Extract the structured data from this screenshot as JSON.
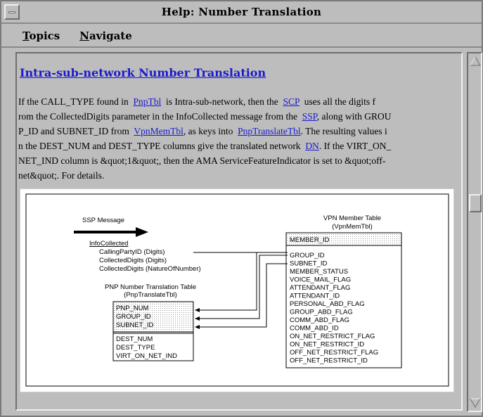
{
  "window": {
    "title": "Help: Number Translation"
  },
  "menubar": {
    "topics_mnemonic": "T",
    "topics_rest": "opics",
    "navigate_mnemonic": "N",
    "navigate_rest": "avigate"
  },
  "content": {
    "heading": "Intra-sub-network Number Translation",
    "para": {
      "t1": "If the CALL_TYPE found in  ",
      "l1": "PnpTbl",
      "t2": "  is Intra-sub-network, then the  ",
      "l2": "SCP",
      "t3": "  uses all the digits f\nrom the CollectedDigits parameter in the InfoCollected message from the  ",
      "l3": "SSP",
      "t4": ", along with GROU\nP_ID and SUBNET_ID from  ",
      "l4": "VpnMemTbl",
      "t5": ", as keys into  ",
      "l5": "PnpTranslateTbl",
      "t6": ". The resulting values i\nn the DEST_NUM and DEST_TYPE columns give the translated network  ",
      "l6": "DN",
      "t7": ". If the VIRT_ON_\nNET_IND column is &quot;1&quot;, then the AMA ServiceFeatureIndicator is set to &quot;off-\nnet&quot;. For details."
    }
  },
  "figure": {
    "ssp_label": "SSP Message",
    "info_collected": "InfoCollected",
    "params": [
      "CallingPartyID (Digits)",
      "CollectedDigits (Digits)",
      "CollectedDigits (NatureOfNumber)"
    ],
    "pnp_title_1": "PNP Number Translation Table",
    "pnp_title_2": "(PnpTranslateTbl)",
    "pnp_keys": [
      "PNP_NUM",
      "GROUP_ID",
      "SUBNET_ID"
    ],
    "pnp_fields": [
      "DEST_NUM",
      "DEST_TYPE",
      "VIRT_ON_NET_IND"
    ],
    "vpn_title_1": "VPN Member Table",
    "vpn_title_2": "(VpnMemTbl)",
    "vpn_key": "MEMBER_ID",
    "vpn_fields": [
      "GROUP_ID",
      "SUBNET_ID",
      "MEMBER_STATUS",
      "VOICE_MAIL_FLAG",
      "ATTENDANT_FLAG",
      "ATTENDANT_ID",
      "PERSONAL_ABD_FLAG",
      "GROUP_ABD_FLAG",
      "COMM_ABD_FLAG",
      "COMM_ABD_ID",
      "ON_NET_RESTRICT_FLAG",
      "ON_NET_RESTRICT_ID",
      "OFF_NET_RESTRICT_FLAG",
      "OFF_NET_RESTRICT_ID"
    ]
  },
  "colors": {
    "link": "#1a1acc",
    "panel": "#bdbdbd",
    "figure_bg": "#ffffff"
  }
}
